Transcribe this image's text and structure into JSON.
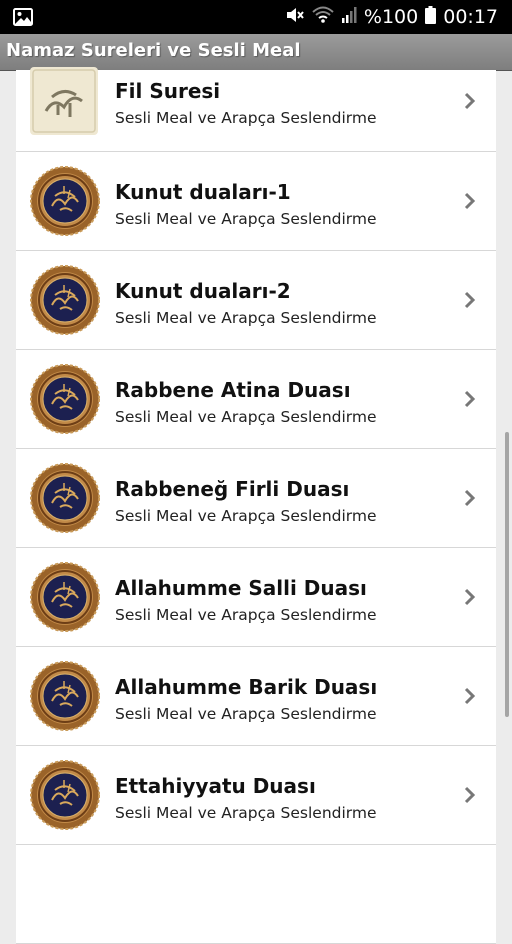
{
  "status_bar": {
    "battery_text": "%100",
    "time": "00:17"
  },
  "app_bar": {
    "title": "Namaz Sureleri ve Sesli Meal"
  },
  "list": {
    "items": [
      {
        "title": "Fil Suresi",
        "subtitle": "Sesli Meal ve Arapça Seslendirme",
        "icon": "calligraphy-square-icon"
      },
      {
        "title": "Kunut duaları-1",
        "subtitle": "Sesli Meal ve Arapça Seslendirme",
        "icon": "calligraphy-round-icon"
      },
      {
        "title": "Kunut duaları-2",
        "subtitle": "Sesli Meal ve Arapça Seslendirme",
        "icon": "calligraphy-round-icon"
      },
      {
        "title": "Rabbene Atina Duası",
        "subtitle": "Sesli Meal ve Arapça Seslendirme",
        "icon": "calligraphy-round-icon"
      },
      {
        "title": "Rabbeneğ Firli Duası",
        "subtitle": "Sesli Meal ve Arapça Seslendirme",
        "icon": "calligraphy-round-icon"
      },
      {
        "title": "Allahumme Salli Duası",
        "subtitle": "Sesli Meal ve Arapça Seslendirme",
        "icon": "calligraphy-round-icon"
      },
      {
        "title": "Allahumme Barik Duası",
        "subtitle": "Sesli Meal ve Arapça Seslendirme",
        "icon": "calligraphy-round-icon"
      },
      {
        "title": "Ettahiyyatu Duası",
        "subtitle": "Sesli Meal ve Arapça Seslendirme",
        "icon": "calligraphy-round-icon"
      },
      {
        "title": "",
        "subtitle": "",
        "icon": ""
      }
    ]
  },
  "colors": {
    "status_bar": "#000000",
    "app_bar": "#8c8c8c",
    "background": "#ececec",
    "row": "#ffffff",
    "medallion": "#a06a2e",
    "medallion_inner": "#1b1f4c"
  }
}
